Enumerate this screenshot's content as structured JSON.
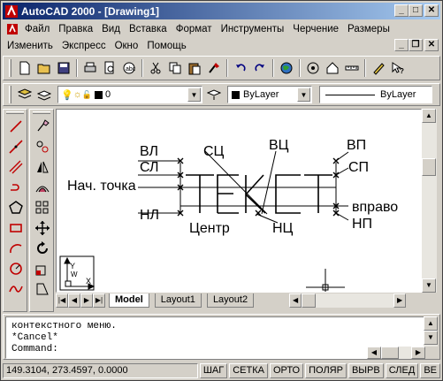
{
  "window": {
    "title": "AutoCAD 2000 - [Drawing1]"
  },
  "menu": {
    "row1": [
      "Файл",
      "Правка",
      "Вид",
      "Вставка",
      "Формат",
      "Инструменты",
      "Черчение",
      "Размеры"
    ],
    "row2": [
      "Изменить",
      "Экспресс",
      "Окно",
      "Помощь"
    ]
  },
  "layer_bar": {
    "layer_name": "0",
    "color_value": "ByLayer",
    "linetype_value": "ByLayer"
  },
  "drawing": {
    "labels": {
      "vl": "ВЛ",
      "sl": "СЛ",
      "start_point": "Нач. точка",
      "nl": "НЛ",
      "sc": "СЦ",
      "vc": "ВЦ",
      "vp": "ВП",
      "sp": "СП",
      "right": "вправо",
      "np": "НП",
      "center": "Центр",
      "nc": "НЦ",
      "main_text": "Текст"
    },
    "ucs": {
      "y": "Y",
      "x": "X",
      "w": "W"
    }
  },
  "layout_tabs": [
    "Model",
    "Layout1",
    "Layout2"
  ],
  "command": {
    "lines": [
      "контекстного меню.",
      "*Cancel*"
    ],
    "prompt": "Command:"
  },
  "status": {
    "coords": "149.3104, 273.4597, 0.0000",
    "toggles": [
      "ШАГ",
      "СЕТКА",
      "ОРТО",
      "ПОЛЯР",
      "ВЫРВ",
      "СЛЕД",
      "ВЕ"
    ]
  }
}
